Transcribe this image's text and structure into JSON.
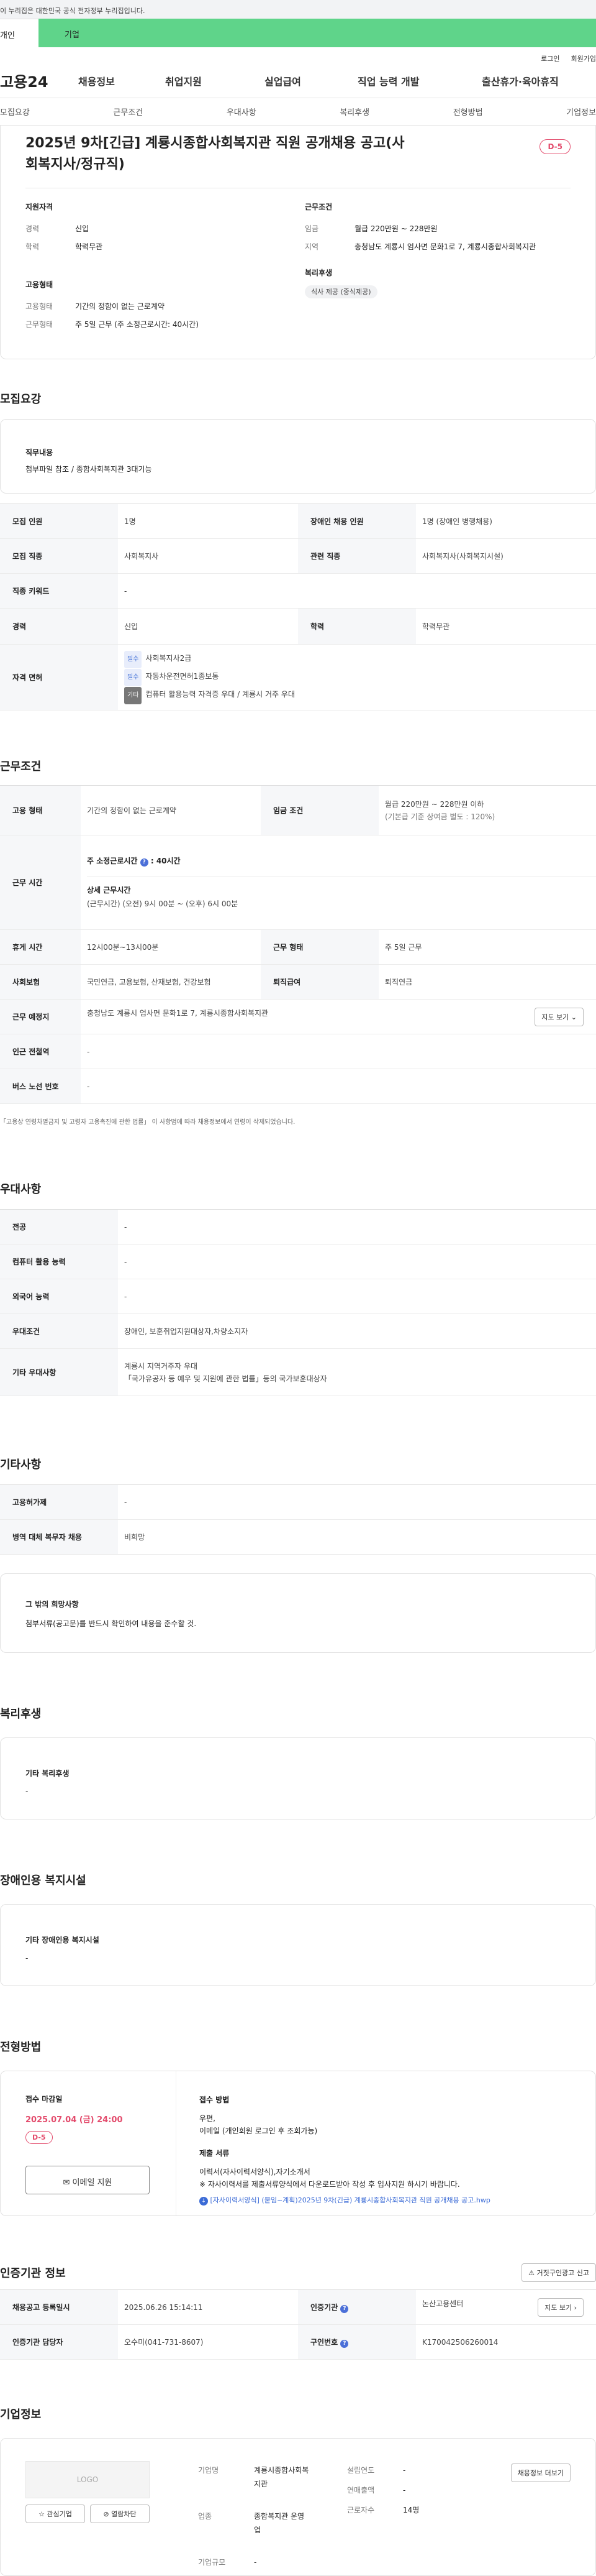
{
  "header": {
    "gov_notice": "이 누리집은 대한민국 공식 전자정부 누리집입니다.",
    "tab_personal": "개인",
    "tab_company": "기업",
    "login": "로그인",
    "signup": "회원가입",
    "logo": "고용24",
    "menu": [
      "채용정보",
      "취업지원",
      "실업급여",
      "직업 능력 개발",
      "출산휴가·육아휴직"
    ]
  },
  "anchor_nav": [
    "모집요강",
    "근무조건",
    "우대사항",
    "복리후생",
    "전형방법",
    "기업정보"
  ],
  "summary": {
    "title": "2025년 9차[긴급] 계룡시종합사회복지관 직원 공개채용 공고(사회복지사/정규직)",
    "dday": "D-5",
    "qual_title": "지원자격",
    "career_k": "경력",
    "career_v": "신입",
    "edu_k": "학력",
    "edu_v": "학력무관",
    "cond_title": "근무조건",
    "wage_k": "임금",
    "wage_v": "월급 220만원 ~ 228만원",
    "loc_k": "지역",
    "loc_v": "충청남도 계룡시 엄사면 문화1로 7, 계룡시종합사회복지관",
    "emp_title": "고용형태",
    "emptype_k": "고용형태",
    "emptype_v": "기간의 정함이 없는 근로계약",
    "form_k": "근무형태",
    "form_v": "주 5일 근무 (주 소정근로시간: 40시간)",
    "welfare_title": "복리후생",
    "welfare_tag": "식사 제공 (중식제공)"
  },
  "recruit": {
    "title": "모집요강",
    "duty_label": "직무내용",
    "duty_value": "첨부파일 참조 / 종합사회복지관 3대기능",
    "headcount_k": "모집 인원",
    "headcount_v": "1명",
    "disabled_k": "장애인 채용 인원",
    "disabled_v": "1명 (장애인 병행채용)",
    "job_k": "모집 직종",
    "job_v": "사회복지사",
    "related_k": "관련 직종",
    "related_v": "사회복지사(사회복지시설)",
    "keyword_k": "직종 키워드",
    "keyword_v": "-",
    "career_k": "경력",
    "career_v": "신입",
    "edu_k": "학력",
    "edu_v": "학력무관",
    "license_k": "자격 면허",
    "licenses": [
      {
        "tag": "필수",
        "name": "사회복지사2급"
      },
      {
        "tag": "필수",
        "name": "자동차운전면허1종보통"
      },
      {
        "tag": "기타",
        "name": "컴퓨터 활용능력 자격증 우대 / 계룡시 거주 우대"
      }
    ]
  },
  "work": {
    "title": "근무조건",
    "emptype_k": "고용 형태",
    "emptype_v": "기간의 정함이 없는 근로계약",
    "wage_k": "임금 조건",
    "wage_v1": "월급 220만원 ~ 228만원 이하",
    "wage_v2": "(기본급 기준 상여금 별도 : 120%)",
    "hours_k": "근무 시간",
    "weekly": "주 소정근로시간",
    "weekly_v": "40시간",
    "detail_label": "상세 근무시간",
    "detail_v": "(근무시간) (오전) 9시 00분 ~ (오후) 6시 00분",
    "rest_k": "휴게 시간",
    "rest_v": "12시00분~13시00분",
    "form_k": "근무 형태",
    "form_v": "주 5일 근무",
    "ins_k": "사회보험",
    "ins_v": "국민연금, 고용보험, 산재보험, 건강보험",
    "sev_k": "퇴직급여",
    "sev_v": "퇴직연금",
    "place_k": "근무 예정지",
    "place_v": "충청남도 계룡시 엄사면 문화1로 7, 계룡시종합사회복지관",
    "map_btn": "지도 보기",
    "sub_k": "인근 전철역",
    "sub_v": "-",
    "bus_k": "버스 노선 번호",
    "bus_v": "-",
    "note": "「고용상 연령차별금지 및 고령자 고용촉진에 관한 법률」 이 사항범에 따라 채용정보에서 연령이 삭제되었습니다."
  },
  "pref": {
    "title": "우대사항",
    "major_k": "전공",
    "major_v": "-",
    "pc_k": "컴퓨터 활용 능력",
    "pc_v": "-",
    "lang_k": "외국어 능력",
    "lang_v": "-",
    "cond_k": "우대조건",
    "cond_v": "장애인, 보훈취업지원대상자,차량소지자",
    "etc_k": "기타 우대사항",
    "etc_v1": "계룡시 지역거주자 우대",
    "etc_v2": "「국가유공자 등 예우 및 지원에 관한 법률」등의 국가보훈대상자"
  },
  "other": {
    "title": "기타사항",
    "hire_k": "고용허가제",
    "hire_v": "-",
    "mil_k": "병역 대체 복무자 채용",
    "mil_v": "비희망",
    "wish_title": "그 밖의 희망사항",
    "wish_v": "첨부서류(공고문)를 반드시 확인하여 내용을 준수할 것."
  },
  "welfare": {
    "title": "복리후생",
    "label": "기타 복리후생",
    "value": "-"
  },
  "facility": {
    "title": "장애인용 복지시설",
    "label": "기타 장애인용 복지시설",
    "value": "-"
  },
  "process": {
    "title": "전형방법",
    "deadline_label": "접수 마감일",
    "deadline": "2025.07.04 (금) 24:00",
    "dday": "D-5",
    "apply_btn": "이메일 지원",
    "method_label": "접수 방법",
    "method_v1": "우편,",
    "method_v2": "이메일 (개인회원 로그인 후 조회가능)",
    "docs_label": "제출 서류",
    "docs_v1": "이력서(자사이력서양식),자기소개서",
    "docs_v2": "※ 자사이력서를 제출서류양식에서 다운로드받아 작성 후 입사지원 하시기 바랍니다.",
    "file": "[자사이력서양식] (붙임~계획)2025년 9차(긴급) 계룡시종합사회복지관 직원 공개채용 공고.hwp"
  },
  "agency": {
    "title": "인증기관 정보",
    "report_btn": "거짓구인광고 신고",
    "reg_k": "채용공고 등록일시",
    "reg_v": "2025.06.26 15:14:11",
    "org_k": "인증기관",
    "org_v": "논산고용센터",
    "map_btn": "지도 보기",
    "mgr_k": "인증기관 담당자",
    "mgr_v": "오수미(041-731-8607)",
    "num_k": "구인번호",
    "num_v": "K170042506260014"
  },
  "company": {
    "title": "기업정보",
    "logo": "LOGO",
    "interest_btn": "관심기업",
    "block_btn": "열람차단",
    "name_k": "기업명",
    "name_v": "계룡시종합사회복지관",
    "ind_k": "업종",
    "ind_v": "종합복지관 운영업",
    "size_k": "기업규모",
    "size_v": "-",
    "year_k": "설립연도",
    "year_v": "-",
    "sales_k": "연매출액",
    "sales_v": "-",
    "emp_k": "근로자수",
    "emp_v": "14명",
    "jobs_btn": "채용정보 더보기"
  }
}
